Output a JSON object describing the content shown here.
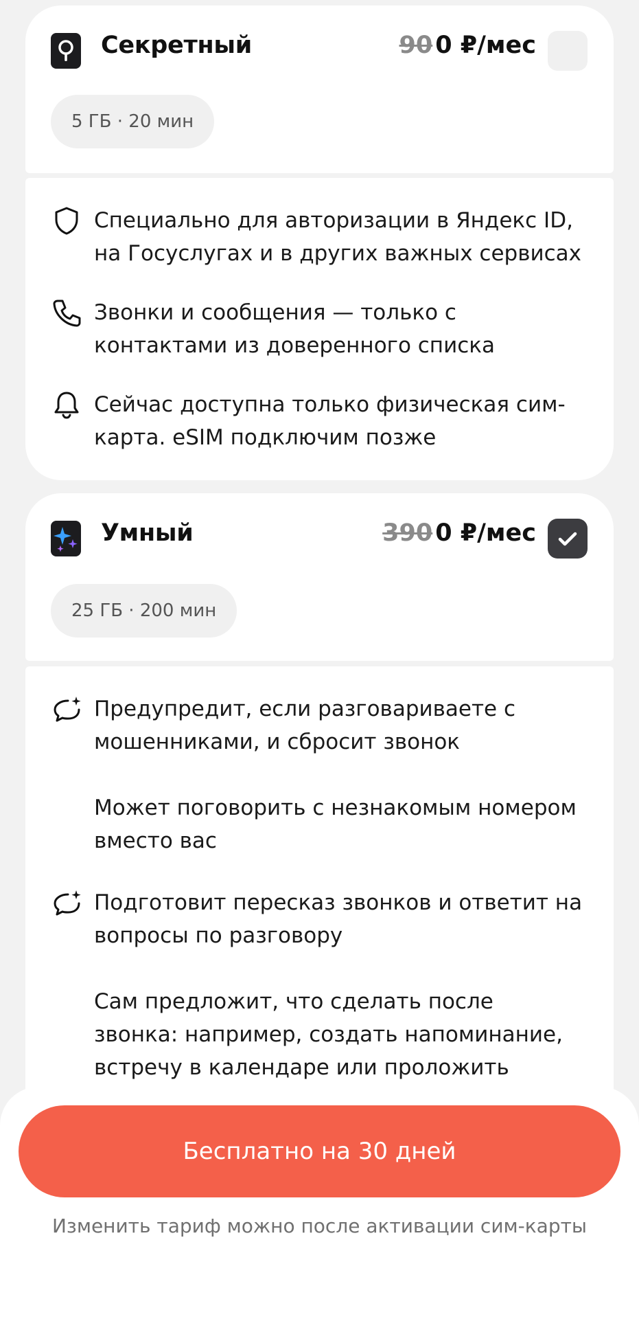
{
  "plans": [
    {
      "name": "Секретный",
      "price_old": "90",
      "price_new": "0 ₽/мес",
      "chip": "5 ГБ · 20 мин",
      "selected": false,
      "features": [
        "Специально для авторизации в Яндекс ID, на Госуслугах и в других важных сервисах",
        "Звонки и сообщения — только с контактами из доверенного списка",
        "Сейчас доступна только физическая сим-карта. eSIM подключим позже"
      ]
    },
    {
      "name": "Умный",
      "price_old": "390",
      "price_new": "0 ₽/мес",
      "chip": "25 ГБ · 200 мин",
      "selected": true,
      "features": [
        "Предупредит, если разговариваете с мошенниками, и сбросит звонок",
        "Может поговорить с незнакомым номером вместо вас",
        "Подготовит пересказ звонков и ответит на вопросы по разговору",
        "Сам предложит, что сделать после звонка: например, создать напоминание, встречу в календаре или проложить маршрут"
      ]
    }
  ],
  "cta": {
    "label": "Бесплатно на 30 дней"
  },
  "hint": "Изменить тариф можно после активации сим-карты",
  "colors": {
    "accent": "#f4604a",
    "checkbox_on": "#3c3c40"
  }
}
